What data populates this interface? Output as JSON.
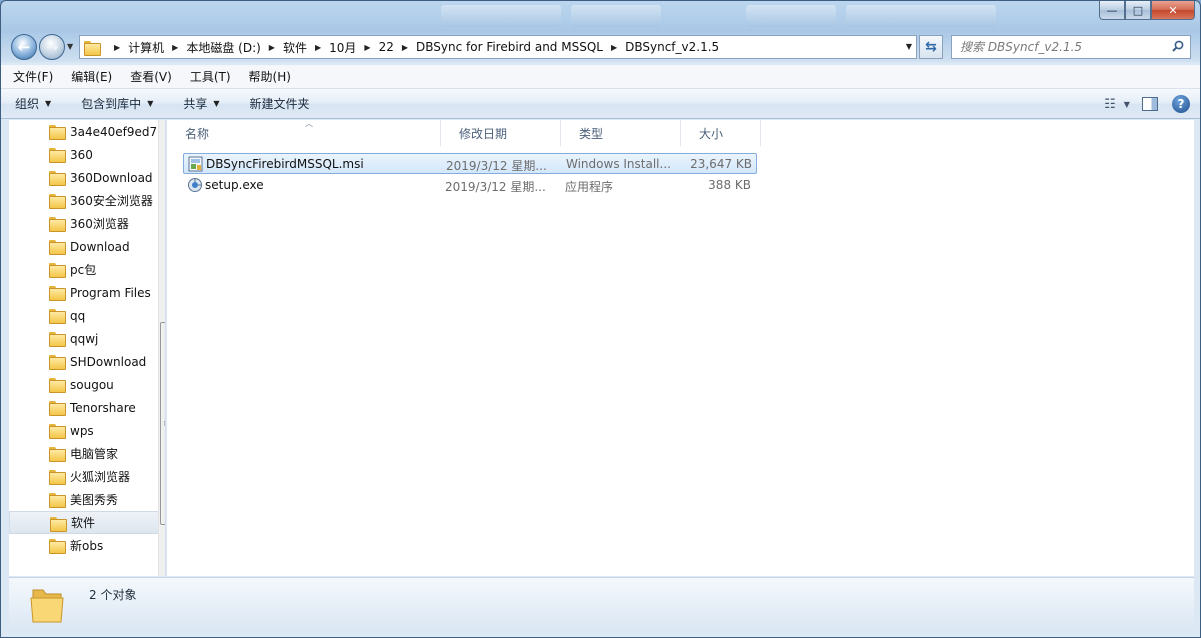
{
  "window": {
    "min_label": "—",
    "max_label": "□",
    "close_label": "✕"
  },
  "address": {
    "crumbs": [
      "计算机",
      "本地磁盘 (D:)",
      "软件",
      "10月",
      "22",
      "DBSync for Firebird and MSSQL",
      "DBSyncf_v2.1.5"
    ]
  },
  "search": {
    "placeholder": "搜索 DBSyncf_v2.1.5"
  },
  "menu": {
    "items": [
      "文件(F)",
      "编辑(E)",
      "查看(V)",
      "工具(T)",
      "帮助(H)"
    ]
  },
  "toolbar": {
    "organize": "组织",
    "include_library": "包含到库中",
    "share": "共享",
    "new_folder": "新建文件夹"
  },
  "nav": {
    "items": [
      "3a4e40ef9ed7",
      "360",
      "360Download",
      "360安全浏览器",
      "360浏览器",
      "Download",
      "pc包",
      "Program Files",
      "qq",
      "qqwj",
      "SHDownload",
      "sougou",
      "Tenorshare",
      "wps",
      "电脑管家",
      "火狐浏览器",
      "美图秀秀",
      "软件",
      "新obs"
    ],
    "selected_index": 17
  },
  "columns": {
    "name": "名称",
    "date": "修改日期",
    "type": "类型",
    "size": "大小"
  },
  "files": [
    {
      "name": "DBSyncFirebirdMSSQL.msi",
      "date": "2019/3/12 星期...",
      "type": "Windows Install...",
      "size": "23,647 KB",
      "icon": "msi-installer-icon",
      "selected": true
    },
    {
      "name": "setup.exe",
      "date": "2019/3/12 星期...",
      "type": "应用程序",
      "size": "388 KB",
      "icon": "setup-exe-icon",
      "selected": false
    }
  ],
  "status": {
    "count": "2 个对象"
  },
  "colors": {
    "selection_border": "#84acdd",
    "folder_yellow": "#f3c648",
    "nav_blue": "#2f6aa8"
  }
}
